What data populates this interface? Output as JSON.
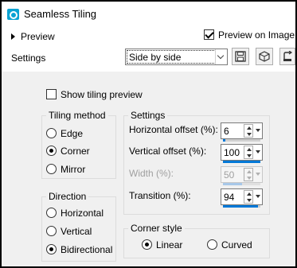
{
  "window": {
    "title": "Seamless Tiling"
  },
  "top": {
    "preview_label": "Preview",
    "preview_on_image_label": "Preview on Image",
    "preview_on_image_checked": true,
    "settings_label": "Settings",
    "preset_value": "Side by side",
    "icons": [
      "save-icon",
      "load-icon",
      "reset-icon"
    ]
  },
  "show_tiling_preview": {
    "label": "Show tiling preview",
    "checked": false
  },
  "tiling_method": {
    "title": "Tiling method",
    "options": [
      "Edge",
      "Corner",
      "Mirror"
    ],
    "selected": "Corner"
  },
  "direction": {
    "title": "Direction",
    "options": [
      "Horizontal",
      "Vertical",
      "Bidirectional"
    ],
    "selected": "Bidirectional"
  },
  "settings": {
    "title": "Settings",
    "horizontal_offset": {
      "label": "Horizontal offset (%):",
      "value": "6",
      "level": 6
    },
    "vertical_offset": {
      "label": "Vertical offset (%):",
      "value": "100",
      "level": 100
    },
    "width": {
      "label": "Width (%):",
      "value": "50",
      "level": 50,
      "disabled": true
    },
    "transition": {
      "label": "Transition (%):",
      "value": "94",
      "level": 94
    }
  },
  "corner_style": {
    "title": "Corner style",
    "options": [
      "Linear",
      "Curved"
    ],
    "selected": "Linear"
  }
}
